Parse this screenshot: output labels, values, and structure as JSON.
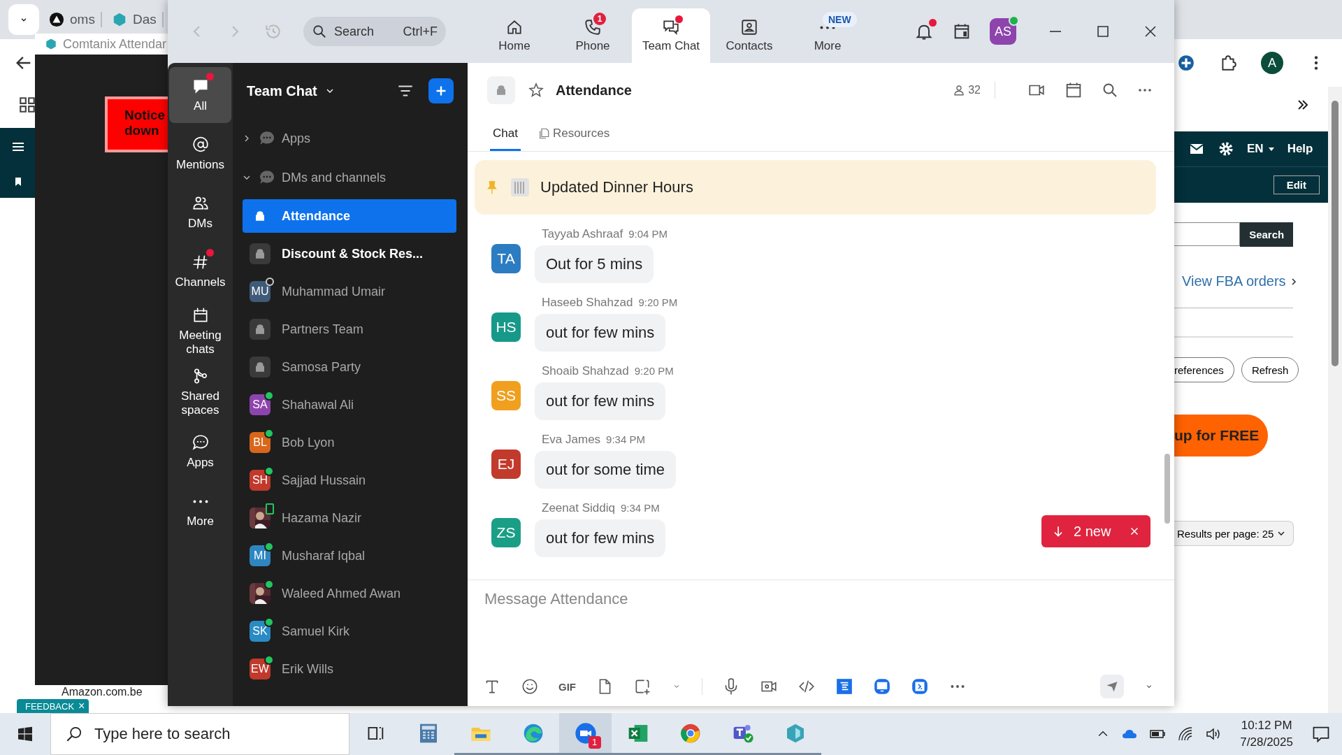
{
  "browser": {
    "tabs": [
      {
        "label": "oms"
      },
      {
        "label": "Das"
      }
    ],
    "profile": "A"
  },
  "popup": {
    "title": "Comtanix Attendar",
    "notice": "Notice\ndown"
  },
  "seller_page": {
    "language": "EN",
    "help": "Help",
    "edit": "Edit",
    "search_button": "Search",
    "link": "View FBA orders",
    "buttons": [
      "references",
      "Refresh"
    ],
    "signup": "up for FREE",
    "results": "Results per page: 25",
    "checkbox_label": "Amazon.com.be",
    "feedback": "FEEDBACK",
    "feedback_close": "×"
  },
  "zoom": {
    "search": {
      "placeholder": "Search",
      "shortcut": "Ctrl+F"
    },
    "nav": [
      {
        "label": "Home",
        "selected": false
      },
      {
        "label": "Phone",
        "selected": false,
        "badge": "1"
      },
      {
        "label": "Team Chat",
        "selected": true,
        "unread": true
      },
      {
        "label": "Contacts",
        "selected": false
      },
      {
        "label": "More",
        "selected": false,
        "badge": "NEW"
      }
    ],
    "notifications_unread": true,
    "profile": {
      "initials": "AS",
      "online": true
    },
    "rail": [
      {
        "label": "All",
        "selected": true,
        "unread": true
      },
      {
        "label": "Mentions",
        "selected": false,
        "unread": false
      },
      {
        "label": "DMs",
        "selected": false,
        "unread": false
      },
      {
        "label": "Channels",
        "selected": false,
        "unread": true
      },
      {
        "label": "Meeting chats",
        "selected": false,
        "unread": false
      },
      {
        "label": "Shared spaces",
        "selected": false,
        "unread": false
      },
      {
        "label": "Apps",
        "selected": false,
        "unread": false
      },
      {
        "label": "More",
        "selected": false,
        "unread": false
      }
    ],
    "list_title": "Team Chat",
    "sections": [
      {
        "label": "Apps",
        "expanded": false
      },
      {
        "label": "DMs and channels",
        "expanded": true
      }
    ],
    "conversations": [
      {
        "name": "Attendance",
        "kind": "channel",
        "selected": true,
        "unread": true
      },
      {
        "name": "Discount & Stock Res...",
        "kind": "channel",
        "selected": false,
        "unread": true
      },
      {
        "name": "Muhammad Umair",
        "kind": "person",
        "initials": "MU",
        "color": "#3f5b78",
        "online": false,
        "selected": false,
        "unread": false
      },
      {
        "name": "Partners Team",
        "kind": "channel",
        "selected": false,
        "unread": false
      },
      {
        "name": "Samosa Party",
        "kind": "channel",
        "selected": false,
        "unread": false
      },
      {
        "name": "Shahawal Ali",
        "kind": "person",
        "initials": "SA",
        "color": "#8e44ad",
        "online": true,
        "selected": false,
        "unread": false
      },
      {
        "name": "Bob Lyon",
        "kind": "person",
        "initials": "BL",
        "color": "#d9661b",
        "online": true,
        "selected": false,
        "unread": false
      },
      {
        "name": "Sajjad Hussain",
        "kind": "person",
        "initials": "SH",
        "color": "#c0392b",
        "online": true,
        "selected": false,
        "unread": false
      },
      {
        "name": "Hazama Nazir",
        "kind": "picture",
        "online": true,
        "mobile": true,
        "selected": false,
        "unread": false
      },
      {
        "name": "Musharaf Iqbal",
        "kind": "person",
        "initials": "MI",
        "color": "#2e86c1",
        "online": true,
        "selected": false,
        "unread": false
      },
      {
        "name": "Waleed Ahmed Awan",
        "kind": "picture",
        "online": true,
        "selected": false,
        "unread": false
      },
      {
        "name": "Samuel Kirk",
        "kind": "person",
        "initials": "SK",
        "color": "#2a8bc4",
        "online": true,
        "selected": false,
        "unread": false
      },
      {
        "name": "Erik Wills",
        "kind": "person",
        "initials": "EW",
        "color": "#c0392b",
        "online": true,
        "selected": false,
        "unread": false
      }
    ],
    "channel": {
      "title": "Attendance",
      "members": "32",
      "tabs": [
        {
          "label": "Chat",
          "selected": true
        },
        {
          "label": "Resources",
          "selected": false
        }
      ],
      "pinned": "Updated Dinner Hours"
    },
    "messages": [
      {
        "sender": "Tayyab Ashraaf",
        "time": "9:04 PM",
        "initials": "TA",
        "color": "#2c7cc1",
        "text": "Out for 5 mins"
      },
      {
        "sender": "Haseeb Shahzad",
        "time": "9:20 PM",
        "initials": "HS",
        "color": "#17998a",
        "text": "out for few mins"
      },
      {
        "sender": "Shoaib Shahzad",
        "time": "9:20 PM",
        "initials": "SS",
        "color": "#f0a01e",
        "text": "out for few mins"
      },
      {
        "sender": "Eva James",
        "time": "9:34 PM",
        "initials": "EJ",
        "color": "#c23a2c",
        "text": "out for some time"
      },
      {
        "sender": "Zeenat Siddiq",
        "time": "9:34 PM",
        "initials": "ZS",
        "color": "#1a9f86",
        "text": "out for few mins"
      }
    ],
    "new_messages": "2 new",
    "composer": {
      "placeholder": "Message Attendance",
      "gif": "GIF"
    }
  },
  "taskbar": {
    "search_placeholder": "Type here to search",
    "apps": [
      {
        "open": false,
        "selected": false
      },
      {
        "open": false,
        "selected": false
      },
      {
        "open": true,
        "selected": false
      },
      {
        "open": true,
        "selected": false
      },
      {
        "open": true,
        "selected": true,
        "badge": "1"
      },
      {
        "open": true,
        "selected": false
      },
      {
        "open": true,
        "selected": false
      },
      {
        "open": true,
        "selected": false
      },
      {
        "open": true,
        "selected": false
      }
    ],
    "time": "10:12 PM",
    "date": "7/28/2025"
  }
}
